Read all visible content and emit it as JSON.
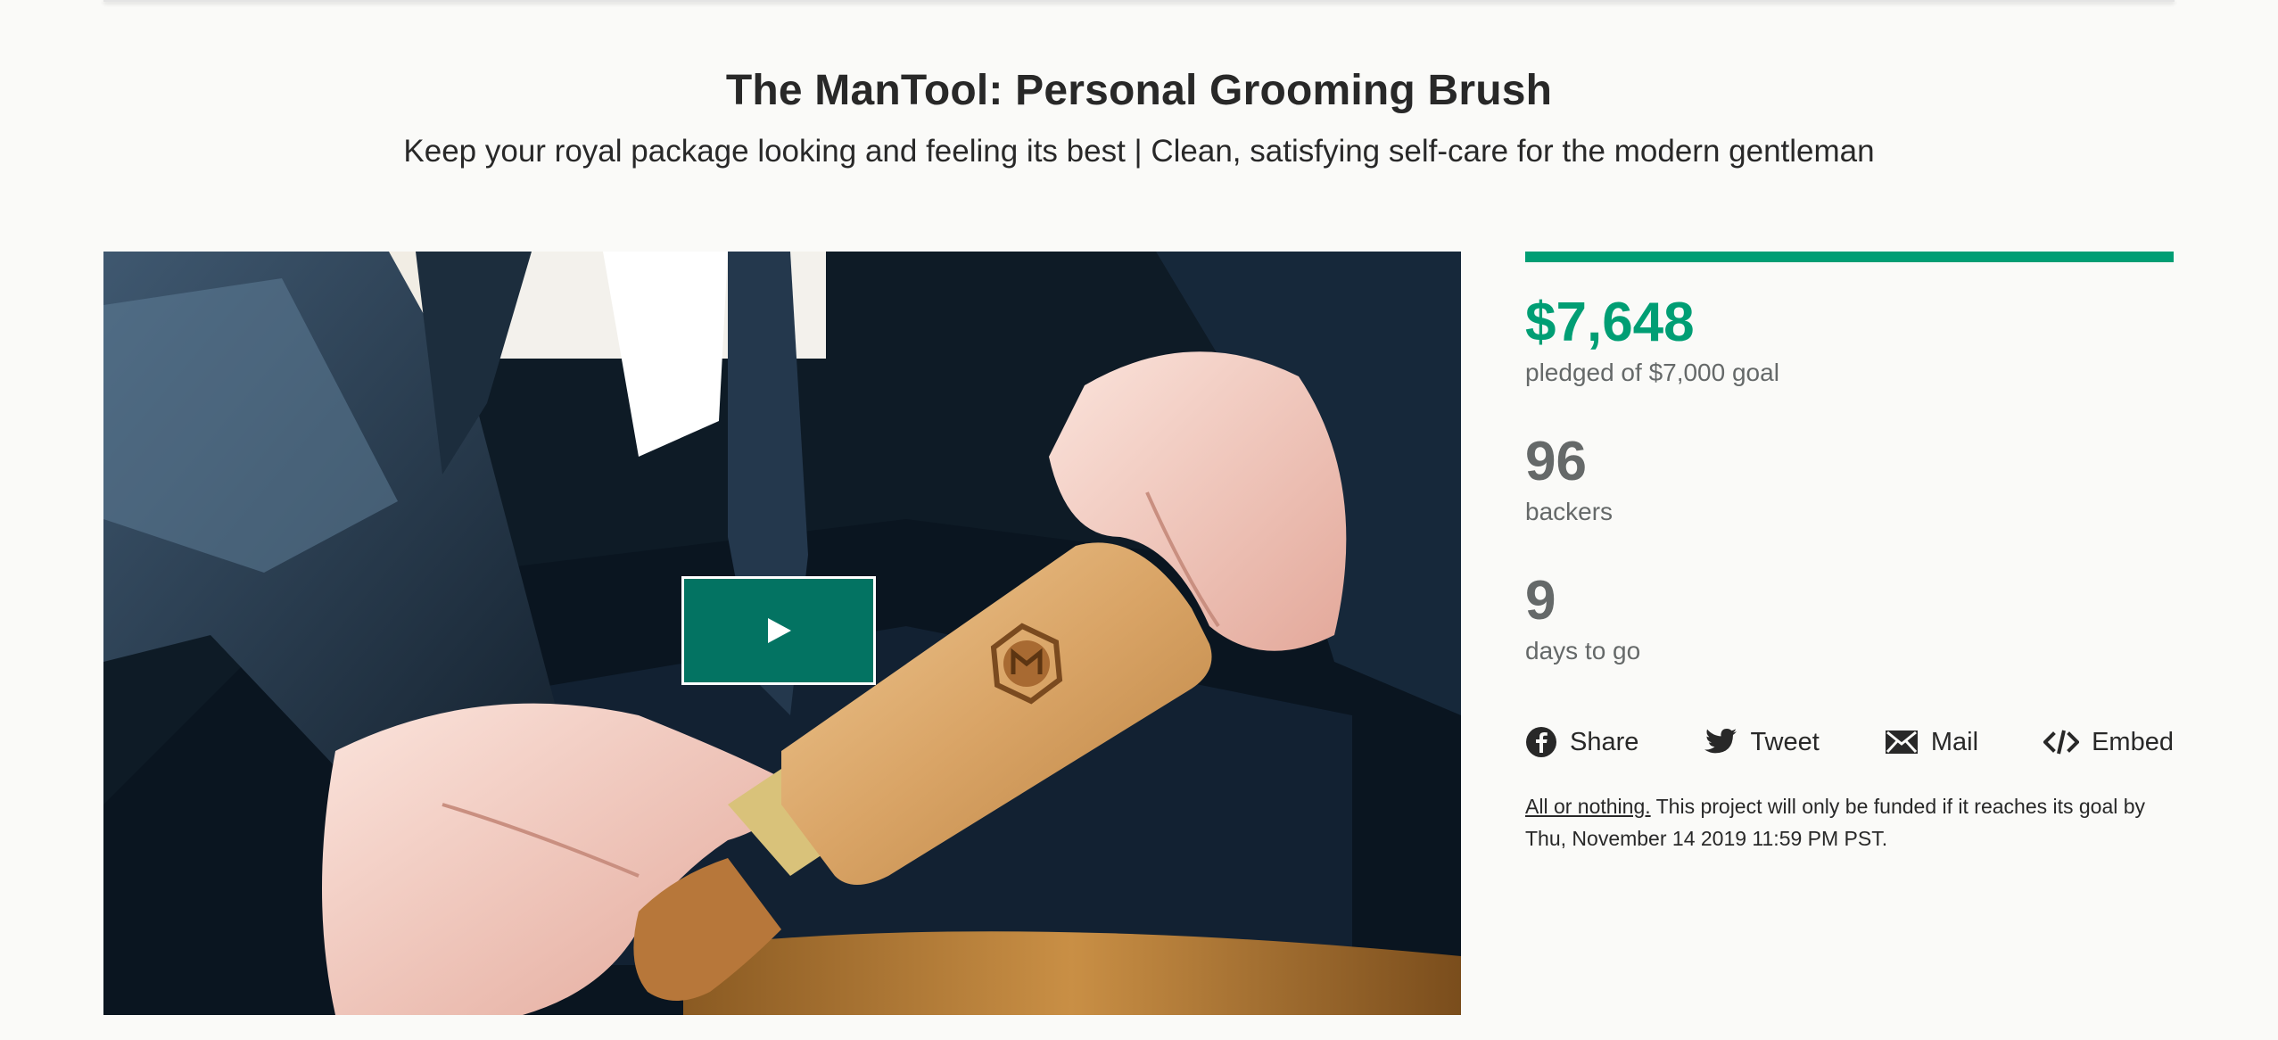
{
  "project": {
    "title": "The ManTool: Personal Grooming Brush",
    "subtitle": "Keep your royal package looking and feeling its best | Clean, satisfying self-care for the modern gentleman"
  },
  "funding": {
    "pledged": "$7,648",
    "pledged_label": "pledged of $7,000 goal",
    "progress_fraction": 1.0,
    "backers": "96",
    "backers_label": "backers",
    "days": "9",
    "days_label": "days to go"
  },
  "share": {
    "share_label": "Share",
    "tweet_label": "Tweet",
    "mail_label": "Mail",
    "embed_label": "Embed"
  },
  "notice": {
    "link_text": "All or nothing.",
    "text": " This project will only be funded if it reaches its goal by Thu, November 14 2019 11:59 PM PST."
  },
  "colors": {
    "accent": "#009e74",
    "play_button": "#037362",
    "muted_text": "#656969"
  },
  "icons": {
    "play": "play-icon",
    "facebook": "facebook-icon",
    "twitter": "twitter-icon",
    "mail": "mail-icon",
    "embed": "embed-icon",
    "logo_badge": "hexagon-m-logo"
  }
}
